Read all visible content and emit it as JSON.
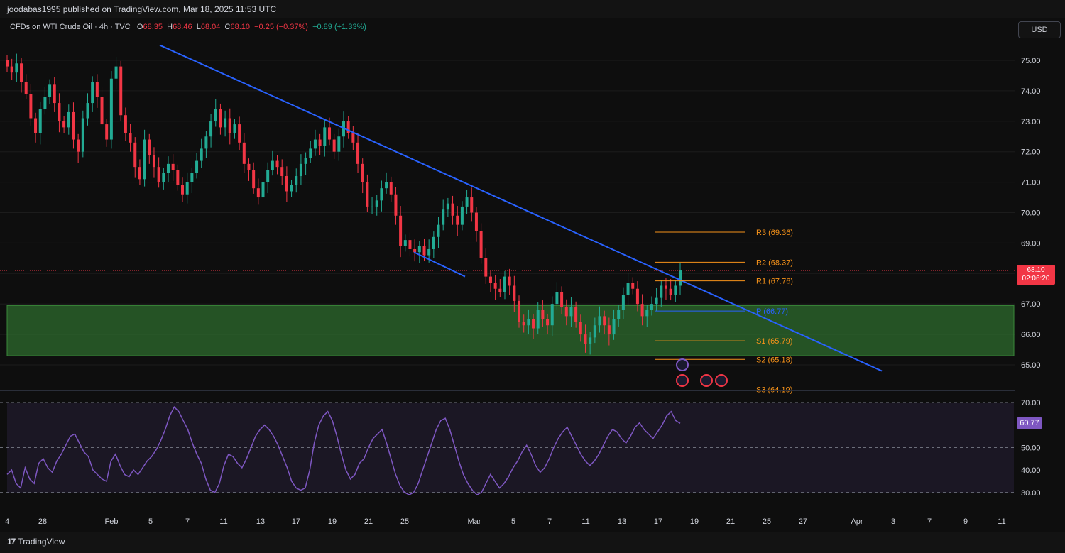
{
  "header": {
    "published_text": "joodabas1995 published on TradingView.com, Mar 18, 2025 11:53 UTC"
  },
  "legend": {
    "symbol": "CFDs on WTI Crude Oil · 4h · TVC",
    "o_label": "O",
    "o_value": "68.35",
    "h_label": "H",
    "h_value": "68.46",
    "l_label": "L",
    "l_value": "68.04",
    "c_label": "C",
    "c_value": "68.10",
    "change": "−0.25 (−0.37%)",
    "change2": "+0.89 (+1.33%)"
  },
  "currency_button": "USD",
  "price_badge": {
    "price": "68.10",
    "countdown": "02:06:20"
  },
  "rsi_badge": "60.77",
  "footer": {
    "brand": "TradingView"
  },
  "colors": {
    "up": "#22ab94",
    "down": "#f23645",
    "trendline": "#2962ff",
    "pivot": "#f7931a",
    "zone": "#2e6b2e",
    "rsi": "#7e57c2"
  },
  "chart_data": {
    "type": "candlestick",
    "timeframe": "4h",
    "price_axis": {
      "ylim": [
        64.2,
        76.0
      ],
      "ticks": [
        "75.00",
        "74.00",
        "73.00",
        "72.00",
        "71.00",
        "70.00",
        "69.00",
        "67.00",
        "66.00",
        "65.00"
      ]
    },
    "x_ticks": [
      "4",
      "28",
      "Feb",
      "5",
      "7",
      "11",
      "13",
      "17",
      "19",
      "21",
      "25",
      "Mar",
      "5",
      "7",
      "11",
      "13",
      "17",
      "19",
      "21",
      "25",
      "27",
      "Apr",
      "3",
      "7",
      "9",
      "11"
    ],
    "closes": [
      74.8,
      74.6,
      74.9,
      74.3,
      73.9,
      73.1,
      72.6,
      73.4,
      73.8,
      74.2,
      73.6,
      73.0,
      72.8,
      73.3,
      72.4,
      72.0,
      73.1,
      73.6,
      74.3,
      73.8,
      72.9,
      72.4,
      74.4,
      74.8,
      73.2,
      72.6,
      72.3,
      71.5,
      71.1,
      72.4,
      71.9,
      71.5,
      71.0,
      71.3,
      71.6,
      71.4,
      70.9,
      70.6,
      71.0,
      71.3,
      71.7,
      72.1,
      72.5,
      73.0,
      73.4,
      72.8,
      73.1,
      72.6,
      72.9,
      72.3,
      71.6,
      71.4,
      70.8,
      70.5,
      71.0,
      71.4,
      71.7,
      71.5,
      71.2,
      70.7,
      70.9,
      71.2,
      71.6,
      71.8,
      72.1,
      72.4,
      72.2,
      72.8,
      72.4,
      72.0,
      72.5,
      73.0,
      72.6,
      72.3,
      71.6,
      71.0,
      70.2,
      70.2,
      70.4,
      70.8,
      71.0,
      70.6,
      69.9,
      68.9,
      69.1,
      68.8,
      68.7,
      68.9,
      68.6,
      68.8,
      69.2,
      69.6,
      70.1,
      70.3,
      69.9,
      69.6,
      70.2,
      70.5,
      70.0,
      69.4,
      68.5,
      67.9,
      67.7,
      67.5,
      67.4,
      67.9,
      67.6,
      67.1,
      66.4,
      66.3,
      66.5,
      66.2,
      66.8,
      66.5,
      66.3,
      67.0,
      67.4,
      66.9,
      66.6,
      66.9,
      66.4,
      66.0,
      65.7,
      65.9,
      66.3,
      66.6,
      66.3,
      66.0,
      66.5,
      66.8,
      67.3,
      67.7,
      67.5,
      67.0,
      66.6,
      66.8,
      67.0,
      67.2,
      67.6,
      67.5,
      67.3,
      67.6,
      68.1
    ],
    "annotations": {
      "trendline": {
        "from": [
          "Feb 5",
          75.5
        ],
        "to": [
          "Apr 2",
          64.8
        ]
      },
      "lower_line": {
        "from": [
          "Feb 25",
          68.7
        ],
        "to": [
          "Mar 1",
          67.9
        ]
      },
      "demand_zone": {
        "from": 65.3,
        "to": 66.95
      },
      "current_price": 68.1
    },
    "pivots": [
      {
        "label": "R3 (69.36)",
        "value": 69.36
      },
      {
        "label": "R2 (68.37)",
        "value": 68.37
      },
      {
        "label": "R1 (67.76)",
        "value": 67.76
      },
      {
        "label": "P (66.77)",
        "value": 66.77
      },
      {
        "label": "S1 (65.79)",
        "value": 65.79
      },
      {
        "label": "S2 (65.18)",
        "value": 65.18
      },
      {
        "label": "S3 (64.19)",
        "value": 64.19
      }
    ],
    "rsi": {
      "ylim": [
        25,
        75
      ],
      "ticks": [
        "70.00",
        "50.00",
        "40.00",
        "30.00"
      ],
      "levels": [
        70,
        50,
        30
      ],
      "current": 60.77,
      "values": [
        38,
        40,
        34,
        32,
        41,
        36,
        34,
        43,
        45,
        41,
        39,
        44,
        47,
        51,
        55,
        56,
        52,
        48,
        46,
        40,
        38,
        36,
        35,
        44,
        47,
        42,
        38,
        37,
        40,
        38,
        41,
        44,
        46,
        49,
        53,
        58,
        64,
        68,
        66,
        62,
        58,
        52,
        47,
        43,
        36,
        31,
        30,
        34,
        42,
        47,
        46,
        43,
        41,
        45,
        50,
        55,
        58,
        60,
        58,
        55,
        51,
        46,
        41,
        35,
        32,
        31,
        32,
        40,
        52,
        60,
        64,
        66,
        62,
        55,
        47,
        40,
        36,
        38,
        43,
        45,
        50,
        54,
        56,
        58,
        52,
        45,
        38,
        33,
        30,
        29,
        30,
        34,
        40,
        46,
        52,
        58,
        62,
        63,
        58,
        51,
        44,
        38,
        34,
        31,
        29,
        30,
        34,
        38,
        35,
        32,
        34,
        37,
        41,
        44,
        48,
        51,
        47,
        42,
        39,
        41,
        45,
        50,
        54,
        57,
        59,
        55,
        51,
        47,
        44,
        42,
        44,
        47,
        51,
        55,
        58,
        57,
        54,
        52,
        55,
        59,
        61,
        58,
        56,
        54,
        57,
        60,
        64,
        66,
        62,
        60.77
      ]
    }
  }
}
